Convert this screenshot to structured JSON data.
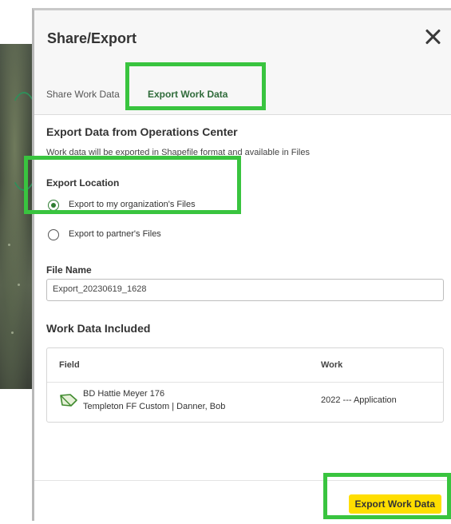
{
  "modal": {
    "title": "Share/Export",
    "close_icon": "close-icon"
  },
  "tabs": [
    {
      "label": "Share Work Data",
      "active": false
    },
    {
      "label": "Export Work Data",
      "active": true
    }
  ],
  "export_section": {
    "title": "Export Data from Operations Center",
    "description": "Work data will be exported in Shapefile format and available in Files"
  },
  "export_location": {
    "label": "Export Location",
    "options": [
      {
        "label": "Export to my organization's Files",
        "selected": true
      },
      {
        "label": "Export to partner's Files",
        "selected": false
      }
    ]
  },
  "file_name": {
    "label": "File Name",
    "value": "Export_20230619_1628"
  },
  "work_data": {
    "title": "Work Data Included",
    "columns": [
      "Field",
      "Work"
    ],
    "rows": [
      {
        "icon": "field-boundary-icon",
        "field_name": "BD Hattie Meyer 176",
        "field_sub": "Templeton FF Custom | Danner, Bob",
        "work": "2022 --- Application"
      }
    ]
  },
  "footer": {
    "export_button": "Export Work Data"
  },
  "colors": {
    "accent_green": "#367c2b",
    "button_yellow": "#ffde00",
    "highlight_green": "#39c43f"
  }
}
